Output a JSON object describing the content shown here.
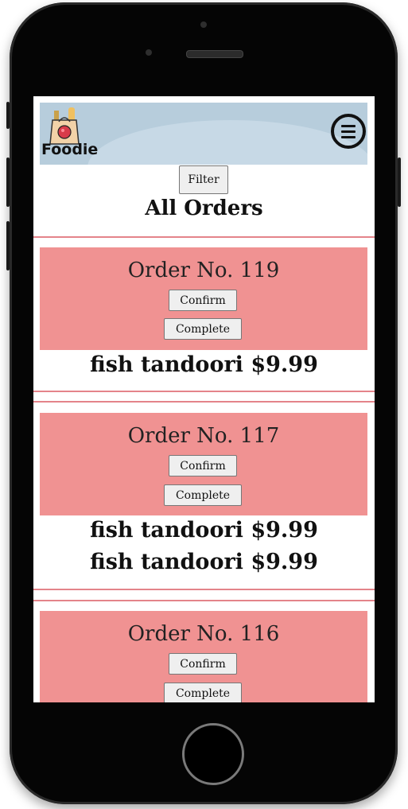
{
  "app": {
    "logo_text": "Foodie"
  },
  "toolbar": {
    "filter_label": "Filter"
  },
  "page": {
    "title": "All Orders"
  },
  "orders": [
    {
      "title": "Order No. 119",
      "confirm_label": "Confirm",
      "complete_label": "Complete",
      "items": [
        "fish tandoori $9.99"
      ]
    },
    {
      "title": "Order No. 117",
      "confirm_label": "Confirm",
      "complete_label": "Complete",
      "items": [
        "fish tandoori $9.99",
        "fish tandoori $9.99"
      ]
    },
    {
      "title": "Order No. 116",
      "confirm_label": "Confirm",
      "complete_label": "Complete",
      "items": []
    }
  ],
  "colors": {
    "header_bg": "#b7cddc",
    "order_bg": "#f09292",
    "divider": "#e4848a"
  },
  "icons": {
    "menu": "menu-icon",
    "logo": "shopping-bag-icon"
  }
}
